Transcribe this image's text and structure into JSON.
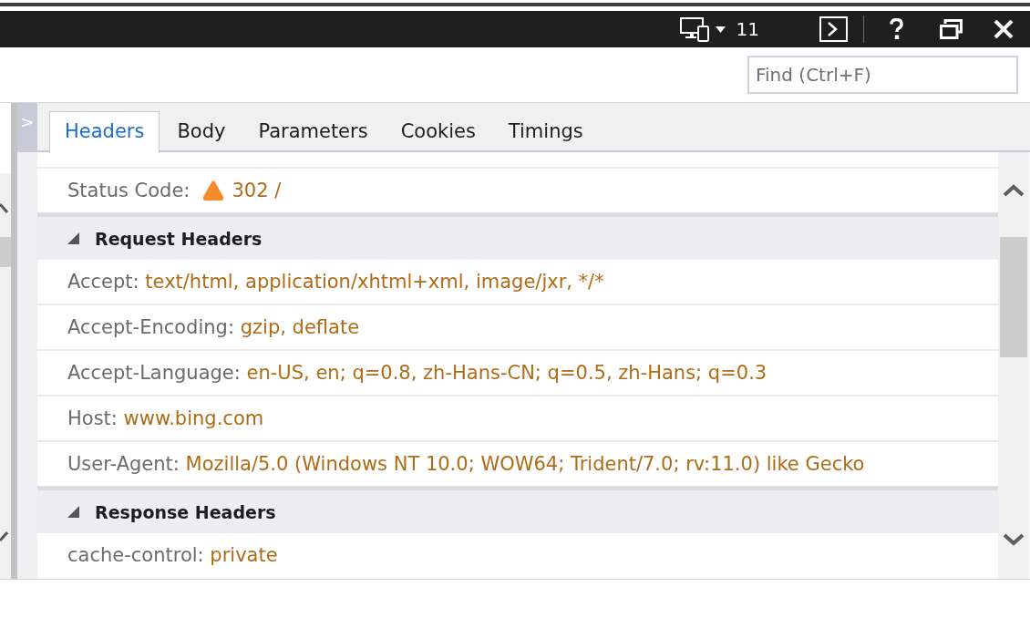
{
  "title_bar": {
    "mode_label": "11"
  },
  "find": {
    "placeholder": "Find (Ctrl+F)"
  },
  "pane_toggle": ">",
  "tabs": [
    {
      "label": "Headers",
      "selected": true
    },
    {
      "label": "Body",
      "selected": false
    },
    {
      "label": "Parameters",
      "selected": false
    },
    {
      "label": "Cookies",
      "selected": false
    },
    {
      "label": "Timings",
      "selected": false
    }
  ],
  "status": {
    "label": "Status Code:",
    "kind": "warning",
    "value": "302 /"
  },
  "sections": [
    {
      "title": "Request Headers",
      "expanded": true,
      "headers": [
        {
          "name": "Accept:",
          "value": "text/html, application/xhtml+xml, image/jxr, */*"
        },
        {
          "name": "Accept-Encoding:",
          "value": "gzip, deflate"
        },
        {
          "name": "Accept-Language:",
          "value": "en-US, en; q=0.8, zh-Hans-CN; q=0.5, zh-Hans; q=0.3"
        },
        {
          "name": "Host:",
          "value": "www.bing.com"
        },
        {
          "name": "User-Agent:",
          "value": "Mozilla/5.0 (Windows NT 10.0; WOW64; Trident/7.0; rv:11.0) like Gecko"
        }
      ]
    },
    {
      "title": "Response Headers",
      "expanded": true,
      "headers": [
        {
          "name": "cache-control:",
          "value": "private"
        }
      ]
    }
  ]
}
